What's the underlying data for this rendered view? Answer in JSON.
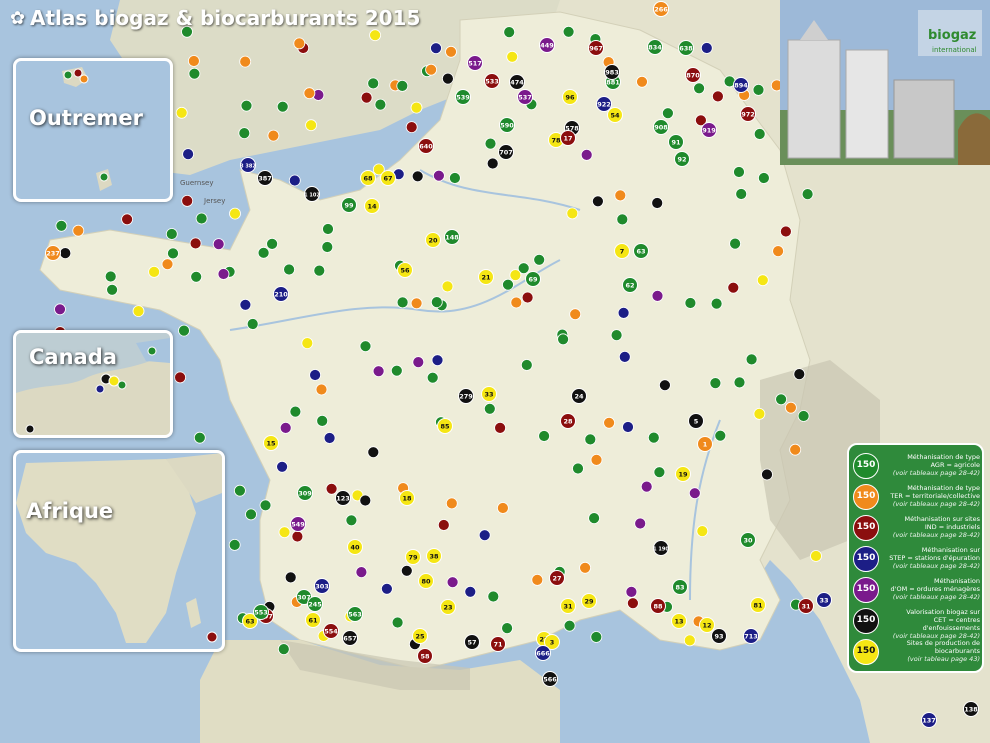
{
  "title": "Atlas biogaz & biocarburants 2015",
  "title_icon": "flower-icon",
  "brand": {
    "name": "biogaz",
    "sub": "international"
  },
  "insets": [
    {
      "id": "outremer",
      "label": "Outremer"
    },
    {
      "id": "canada",
      "label": "Canada"
    },
    {
      "id": "afrique",
      "label": "Afrique"
    }
  ],
  "place_labels": {
    "guernsey": "Guernsey",
    "jersey": "Jersey"
  },
  "colors": {
    "agr": "#1f8a2c",
    "ter": "#f08a1c",
    "ind": "#8b0e0e",
    "step": "#1c1e86",
    "om": "#7a1a8c",
    "cet": "#111111",
    "bio": "#f5e614",
    "sea": "#a8c4de",
    "land": "#e8e7d6",
    "legend_bg": "#2f8a3b"
  },
  "legend": [
    {
      "key": "agr",
      "count": "150",
      "line1": "Méthanisation de type",
      "line2": "AGR = agricole",
      "line3": "(voir tableaux page 28-42)"
    },
    {
      "key": "ter",
      "count": "150",
      "line1": "Méthanisation de type",
      "line2": "TER = territoriale/collective",
      "line3": "(voir tableaux page 28-42)"
    },
    {
      "key": "ind",
      "count": "150",
      "line1": "Méthanisation sur sites",
      "line2": "IND = industriels",
      "line3": "(voir tableaux page 28-42)"
    },
    {
      "key": "step",
      "count": "150",
      "line1": "Méthanisation sur",
      "line2": "STEP = stations d'épuration",
      "line3": "(voir tableaux page 28-42)"
    },
    {
      "key": "om",
      "count": "150",
      "line1": "Méthanisation",
      "line2": "d'OM = ordures ménagères",
      "line3": "(voir tableaux page 28-42)"
    },
    {
      "key": "cet",
      "count": "150",
      "line1": "Valorisation biogaz sur",
      "line2": "CET = centres d'enfouissements",
      "line3": "(voir tableaux page 28-42)"
    },
    {
      "key": "bio",
      "count": "150",
      "line1": "Sites de production de",
      "line2": "biocarburants",
      "line3": "(voir tableau page 43)"
    }
  ],
  "markers": [
    {
      "n": "839",
      "k": "agr"
    },
    {
      "n": "929",
      "k": "agr"
    },
    {
      "n": "967",
      "k": "ind"
    },
    {
      "n": "834",
      "k": "agr"
    },
    {
      "n": "638",
      "k": "agr"
    },
    {
      "n": "517",
      "k": "om"
    },
    {
      "n": "533",
      "k": "ind"
    },
    {
      "n": "474",
      "k": "cet"
    },
    {
      "n": "881",
      "k": "agr"
    },
    {
      "n": "983",
      "k": "cet"
    },
    {
      "n": "870",
      "k": "ind"
    },
    {
      "n": "894",
      "k": "step"
    },
    {
      "n": "539",
      "k": "agr"
    },
    {
      "n": "537",
      "k": "om"
    },
    {
      "n": "96",
      "k": "bio"
    },
    {
      "n": "922",
      "k": "step"
    },
    {
      "n": "972",
      "k": "ind"
    },
    {
      "n": "54",
      "k": "bio"
    },
    {
      "n": "578",
      "k": "cet"
    },
    {
      "n": "590",
      "k": "agr"
    },
    {
      "n": "908",
      "k": "agr"
    },
    {
      "n": "919",
      "k": "om"
    },
    {
      "n": "91",
      "k": "agr"
    },
    {
      "n": "78",
      "k": "bio"
    },
    {
      "n": "640",
      "k": "ind"
    },
    {
      "n": "707",
      "k": "cet"
    },
    {
      "n": "17",
      "k": "ind"
    },
    {
      "n": "92",
      "k": "agr"
    },
    {
      "n": "3 382",
      "k": "step"
    },
    {
      "n": "387",
      "k": "cet"
    },
    {
      "n": "68",
      "k": "bio"
    },
    {
      "n": "67",
      "k": "bio"
    },
    {
      "n": "14",
      "k": "bio"
    },
    {
      "n": "99",
      "k": "agr"
    },
    {
      "n": "1 102",
      "k": "cet"
    },
    {
      "n": "20",
      "k": "bio"
    },
    {
      "n": "7",
      "k": "bio"
    },
    {
      "n": "63",
      "k": "agr"
    },
    {
      "n": "148",
      "k": "agr"
    },
    {
      "n": "237",
      "k": "ter"
    },
    {
      "n": "21",
      "k": "bio"
    },
    {
      "n": "56",
      "k": "bio"
    },
    {
      "n": "62",
      "k": "agr"
    },
    {
      "n": "210",
      "k": "step"
    },
    {
      "n": "69",
      "k": "agr"
    },
    {
      "n": "28",
      "k": "ind"
    },
    {
      "n": "24",
      "k": "cet"
    },
    {
      "n": "279",
      "k": "cet"
    },
    {
      "n": "33",
      "k": "bio"
    },
    {
      "n": "85",
      "k": "bio"
    },
    {
      "n": "5",
      "k": "cet"
    },
    {
      "n": "1",
      "k": "ter"
    },
    {
      "n": "15",
      "k": "bio"
    },
    {
      "n": "19",
      "k": "bio"
    },
    {
      "n": "123",
      "k": "cet"
    },
    {
      "n": "18",
      "k": "bio"
    },
    {
      "n": "40",
      "k": "bio"
    },
    {
      "n": "79",
      "k": "bio"
    },
    {
      "n": "38",
      "k": "bio"
    },
    {
      "n": "30",
      "k": "agr"
    },
    {
      "n": "80",
      "k": "bio"
    },
    {
      "n": "23",
      "k": "bio"
    },
    {
      "n": "31",
      "k": "bio"
    },
    {
      "n": "29",
      "k": "bio"
    },
    {
      "n": "81",
      "k": "bio"
    },
    {
      "n": "27",
      "k": "ind"
    },
    {
      "n": "22",
      "k": "bio"
    },
    {
      "n": "25",
      "k": "bio"
    },
    {
      "n": "57",
      "k": "cet"
    },
    {
      "n": "71",
      "k": "ind"
    },
    {
      "n": "3",
      "k": "bio"
    },
    {
      "n": "93",
      "k": "cet"
    },
    {
      "n": "12",
      "k": "bio"
    },
    {
      "n": "13",
      "k": "bio"
    },
    {
      "n": "88",
      "k": "ind"
    },
    {
      "n": "83",
      "k": "agr"
    },
    {
      "n": "713",
      "k": "step"
    },
    {
      "n": "31",
      "k": "ind"
    },
    {
      "n": "33",
      "k": "step"
    },
    {
      "n": "666",
      "k": "step"
    },
    {
      "n": "566",
      "k": "cet"
    },
    {
      "n": "137",
      "k": "step"
    },
    {
      "n": "138",
      "k": "cet"
    },
    {
      "n": "1 190",
      "k": "cet"
    },
    {
      "n": "307",
      "k": "agr"
    },
    {
      "n": "303",
      "k": "step"
    },
    {
      "n": "61",
      "k": "bio"
    },
    {
      "n": "563",
      "k": "agr"
    },
    {
      "n": "554",
      "k": "ind"
    },
    {
      "n": "657",
      "k": "cet"
    },
    {
      "n": "58",
      "k": "ind"
    },
    {
      "n": "797",
      "k": "ind"
    },
    {
      "n": "63",
      "k": "bio"
    },
    {
      "n": "553",
      "k": "agr"
    },
    {
      "n": "549",
      "k": "om"
    },
    {
      "n": "245",
      "k": "agr"
    },
    {
      "n": "309",
      "k": "agr"
    },
    {
      "n": "247",
      "k": "ind"
    },
    {
      "n": "266",
      "k": "ter"
    },
    {
      "n": "449",
      "k": "om"
    }
  ]
}
